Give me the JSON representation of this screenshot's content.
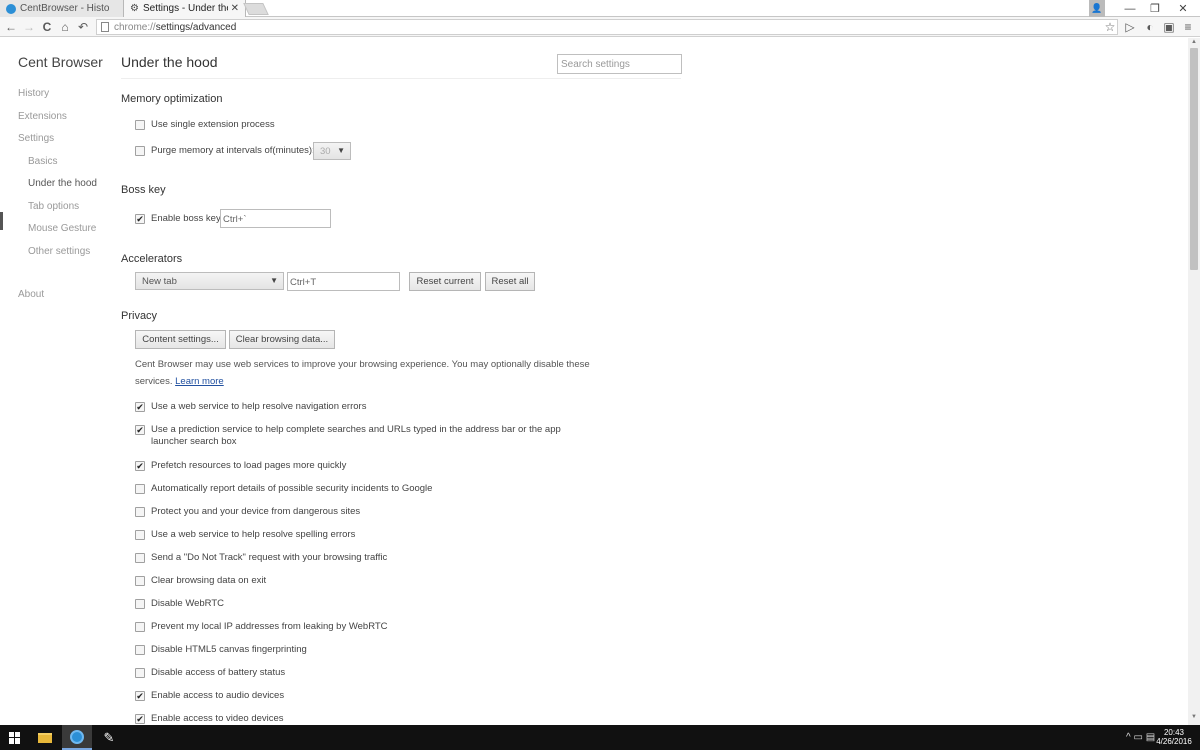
{
  "tabs": [
    {
      "label": "CentBrowser - Histo",
      "close": ""
    },
    {
      "label": "Settings - Under the",
      "close": "✕"
    }
  ],
  "window_controls": {
    "user": "👤",
    "minimize": "—",
    "maximize": "❐",
    "close": "✕"
  },
  "toolbar": {
    "back": "←",
    "forward": "→",
    "reload": "C",
    "home": "⌂",
    "undo": "↶",
    "url_scheme": "chrome://",
    "url_rest": "settings/advanced",
    "star": "☆",
    "play": "▷",
    "ext1": "◐",
    "ext2": "▣",
    "menu": "≡"
  },
  "sidebar": {
    "brand": "Cent Browser",
    "items": [
      {
        "label": "History"
      },
      {
        "label": "Extensions"
      },
      {
        "label": "Settings"
      },
      {
        "label": "Basics"
      },
      {
        "label": "Under the hood"
      },
      {
        "label": "Tab options"
      },
      {
        "label": "Mouse Gesture"
      },
      {
        "label": "Other settings"
      },
      {
        "label": "About"
      }
    ]
  },
  "main": {
    "title": "Under the hood",
    "search_placeholder": "Search settings",
    "memory": {
      "title": "Memory optimization",
      "single_process": {
        "label": "Use single extension process",
        "checked": false
      },
      "purge": {
        "label": "Purge memory at intervals of(minutes):",
        "checked": false,
        "value": "30"
      }
    },
    "bosskey": {
      "title": "Boss key",
      "enable": {
        "label": "Enable boss key",
        "checked": true
      },
      "shortcut": "Ctrl+`"
    },
    "accelerators": {
      "title": "Accelerators",
      "selected": "New tab",
      "shortcut": "Ctrl+T",
      "reset_current": "Reset current",
      "reset_all": "Reset all"
    },
    "privacy": {
      "title": "Privacy",
      "content_settings": "Content settings...",
      "clear_data": "Clear browsing data...",
      "description": "Cent Browser may use web services to improve your browsing experience. You may optionally disable these services.",
      "learn_more": "Learn more",
      "options": [
        {
          "label": "Use a web service to help resolve navigation errors",
          "checked": true
        },
        {
          "label": "Use a prediction service to help complete searches and URLs typed in the address bar or the app launcher search box",
          "checked": true
        },
        {
          "label": "Prefetch resources to load pages more quickly",
          "checked": true
        },
        {
          "label": "Automatically report details of possible security incidents to Google",
          "checked": false
        },
        {
          "label": "Protect you and your device from dangerous sites",
          "checked": false
        },
        {
          "label": "Use a web service to help resolve spelling errors",
          "checked": false
        },
        {
          "label": "Send a \"Do Not Track\" request with your browsing traffic",
          "checked": false
        },
        {
          "label": "Clear browsing data on exit",
          "checked": false
        },
        {
          "label": "Disable WebRTC",
          "checked": false
        },
        {
          "label": "Prevent my local IP addresses from leaking by WebRTC",
          "checked": false
        },
        {
          "label": "Disable HTML5 canvas fingerprinting",
          "checked": false
        },
        {
          "label": "Disable access of battery status",
          "checked": false
        },
        {
          "label": "Enable access to audio devices",
          "checked": true
        },
        {
          "label": "Enable access to video devices",
          "checked": true
        }
      ]
    }
  },
  "taskbar": {
    "time": "20:43",
    "date": "4/26/2016",
    "tray_icons": "^  ▭  ▤"
  },
  "colors": {
    "accent": "#2c8fd6",
    "link": "#2150a0",
    "taskbar": "#111111"
  }
}
